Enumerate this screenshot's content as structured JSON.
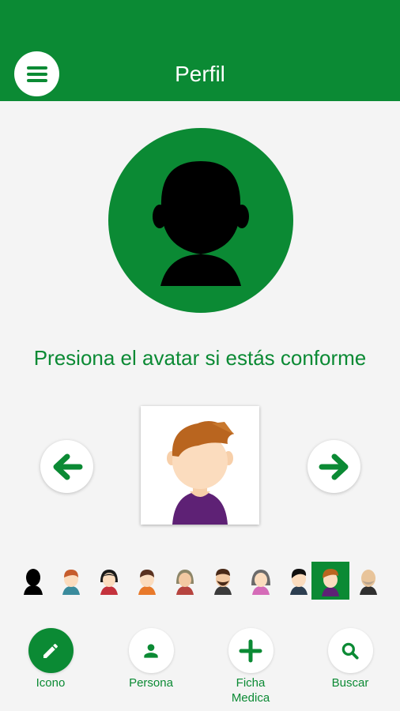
{
  "header": {
    "title": "Perfil",
    "menu_icon": "menu-icon"
  },
  "instruction": "Presiona el avatar si estás conforme",
  "thumbnails": [
    {
      "name": "avatar-silhouette",
      "selected": false
    },
    {
      "name": "avatar-boy-red-hair",
      "selected": false
    },
    {
      "name": "avatar-girl-black-hair",
      "selected": false
    },
    {
      "name": "avatar-boy-dark-hair",
      "selected": false
    },
    {
      "name": "avatar-elder-woman",
      "selected": false
    },
    {
      "name": "avatar-man-beard",
      "selected": false
    },
    {
      "name": "avatar-woman-gray-hair",
      "selected": false
    },
    {
      "name": "avatar-boy-black-hair",
      "selected": false
    },
    {
      "name": "avatar-boy-brown-hair",
      "selected": true
    },
    {
      "name": "avatar-bald-man",
      "selected": false
    }
  ],
  "bottom_nav": [
    {
      "label": "Icono",
      "icon": "pencil-icon",
      "active": true
    },
    {
      "label": "Persona",
      "icon": "person-icon",
      "active": false
    },
    {
      "label": "Ficha Medica",
      "icon": "plus-icon",
      "active": false
    },
    {
      "label": "Buscar",
      "icon": "search-icon",
      "active": false
    }
  ],
  "colors": {
    "primary": "#0b8a34",
    "background": "#f4f4f4",
    "white": "#ffffff"
  }
}
